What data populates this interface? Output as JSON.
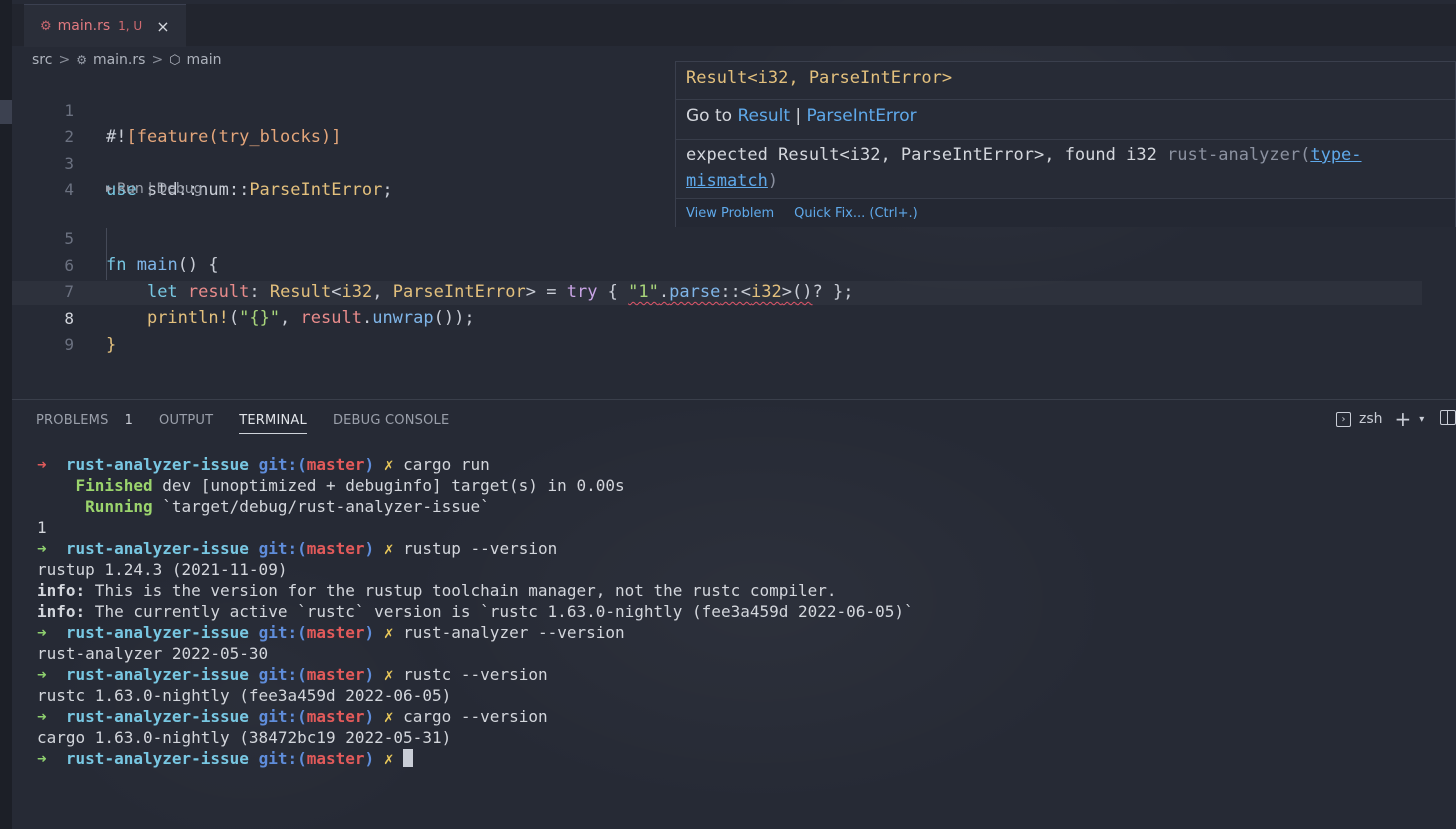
{
  "tab": {
    "icon": "rust-file-icon",
    "name": "main.rs",
    "status": "1, U",
    "close": "×"
  },
  "breadcrumb": {
    "folder": "src",
    "file": "main.rs",
    "symbol": "main",
    "sep": ">"
  },
  "editor": {
    "line_numbers": [
      "1",
      "2",
      "3",
      "4",
      "5",
      "6",
      "7",
      "8",
      "9"
    ],
    "codelens": {
      "run": "Run",
      "sep": "|",
      "debug": "Debug"
    },
    "line1": {
      "a": "#!",
      "b": "[",
      "c": "feature",
      "d": "(",
      "e": "try_blocks",
      "f": ")",
      "g": "]"
    },
    "line3": {
      "kw": "use",
      "path": " std::num::",
      "ty": "ParseIntError",
      "end": ";"
    },
    "line5": {
      "kw": "fn",
      "name": "main",
      "rest": "() {"
    },
    "line6": {
      "kw": "let",
      "var": "result",
      "colon": ": ",
      "ty": "Result",
      "lt": "<",
      "i32": "i32",
      "comma": ", ",
      "err": "ParseIntError",
      "gt": "> = ",
      "try": "try",
      "brace": " { ",
      "str": "\"1\"",
      "dot": ".",
      "parse": "parse",
      "turbo": "::<",
      "ty2": "i32",
      "tail": ">()",
      "q": "?",
      "end": " };"
    },
    "line7": {
      "mac": "println!",
      "open": "(",
      "str": "\"{}\"",
      "comma": ", ",
      "var": "result",
      "dot": ".",
      "fn": "unwrap",
      "end": "());"
    },
    "line8": {
      "brace": "}"
    }
  },
  "hover": {
    "signature": "Result<i32, ParseIntError>",
    "goto_prefix": "Go to ",
    "goto_result": "Result",
    "goto_sep": " | ",
    "goto_err": "ParseIntError",
    "message": "expected Result<i32, ParseIntError>, found i32 ",
    "source": "rust-analyzer(",
    "code": "type-mismatch",
    "source_end": ")",
    "view_problem": "View Problem",
    "quick_fix": "Quick Fix... (Ctrl+.)"
  },
  "panel": {
    "tabs": [
      {
        "label": "PROBLEMS",
        "badge": "1"
      },
      {
        "label": "OUTPUT"
      },
      {
        "label": "TERMINAL"
      },
      {
        "label": "DEBUG CONSOLE"
      }
    ],
    "shell": "zsh"
  },
  "terminal": {
    "prompt": {
      "arrow": "➜",
      "dir": "rust-analyzer-issue",
      "git": "git:(",
      "branch": "master",
      "git_end": ")",
      "x": "✗"
    },
    "cmd1": "cargo run",
    "finished_label": "Finished",
    "finished_text": " dev [unoptimized + debuginfo] target(s) in 0.00s",
    "running_label": "Running",
    "running_text": " `target/debug/rust-analyzer-issue`",
    "out1": "1",
    "cmd2": "rustup --version",
    "out2": "rustup 1.24.3 (2021-11-09)",
    "info_label": "info:",
    "info1": " This is the version for the rustup toolchain manager, not the rustc compiler.",
    "info2": " The currently active `rustc` version is `rustc 1.63.0-nightly (fee3a459d 2022-06-05)`",
    "cmd3": "rust-analyzer --version",
    "out3": "rust-analyzer 2022-05-30",
    "cmd4": "rustc --version",
    "out4": "rustc 1.63.0-nightly (fee3a459d 2022-06-05)",
    "cmd5": "cargo --version",
    "out5": "cargo 1.63.0-nightly (38472bc19 2022-05-31)"
  }
}
